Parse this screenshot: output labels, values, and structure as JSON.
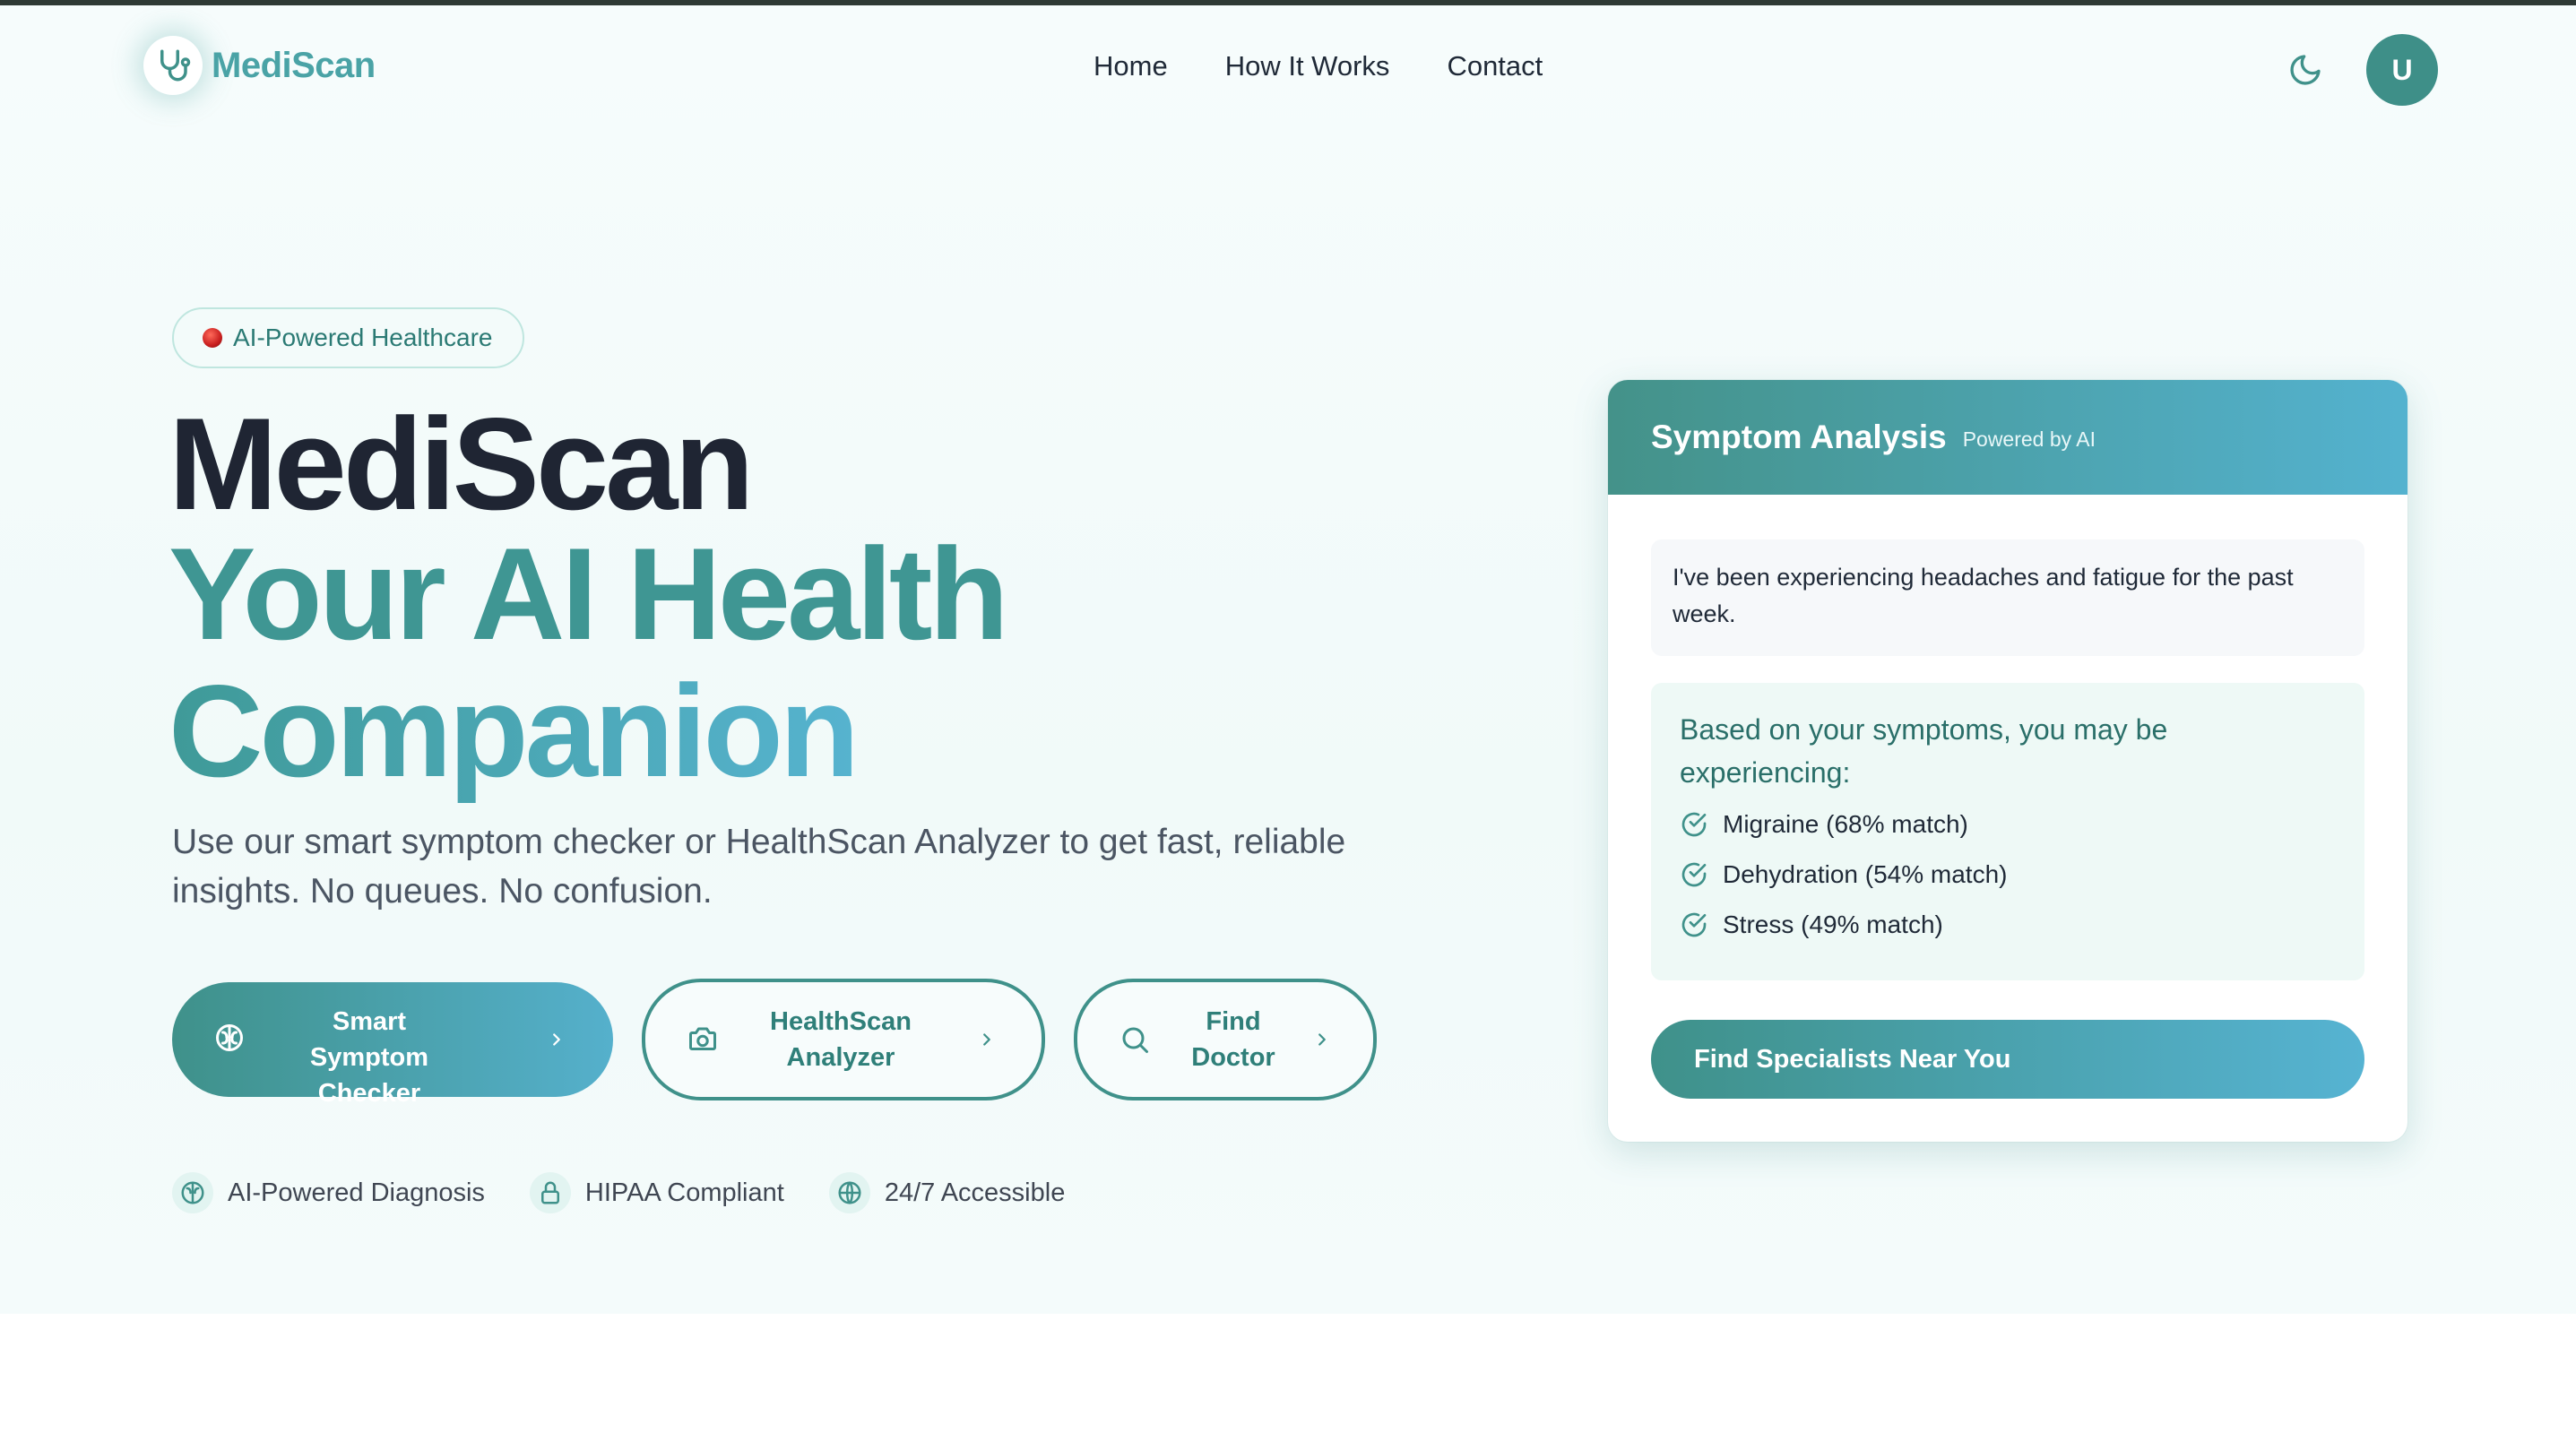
{
  "brand": {
    "name": "MediScan",
    "accent": "#3f918a",
    "accent_light": "#55b0cc"
  },
  "nav": {
    "links": [
      "Home",
      "How It Works",
      "Contact"
    ]
  },
  "header": {
    "theme_icon": "moon-icon",
    "avatar_initial": "U"
  },
  "hero": {
    "badge": "AI-Powered Healthcare",
    "title_line1": "MediScan",
    "title_line2": "Your AI Health",
    "title_line3": "Companion",
    "lead": "Use our smart symptom checker or HealthScan Analyzer to get fast, reliable insights. No queues. No confusion.",
    "buttons": [
      {
        "line1": "Smart Symptom",
        "line2": "Checker",
        "icon": "brain-icon"
      },
      {
        "line1": "HealthScan",
        "line2": "Analyzer",
        "icon": "camera-icon"
      },
      {
        "line1": "Find",
        "line2": "Doctor",
        "icon": "search-icon"
      }
    ],
    "features": [
      {
        "label": "AI-Powered Diagnosis",
        "icon": "brain-icon"
      },
      {
        "label": "HIPAA Compliant",
        "icon": "lock-icon"
      },
      {
        "label": "24/7 Accessible",
        "icon": "globe-icon"
      }
    ]
  },
  "card": {
    "title": "Symptom Analysis",
    "subtitle": "Powered by AI",
    "user_message": "I've been experiencing headaches and fatigue for the past week.",
    "ai_intro": "Based on your symptoms, you may be experiencing:",
    "diagnoses": [
      "Migraine (68% match)",
      "Dehydration (54% match)",
      "Stress (49% match)"
    ],
    "cta": "Find Specialists Near You"
  }
}
